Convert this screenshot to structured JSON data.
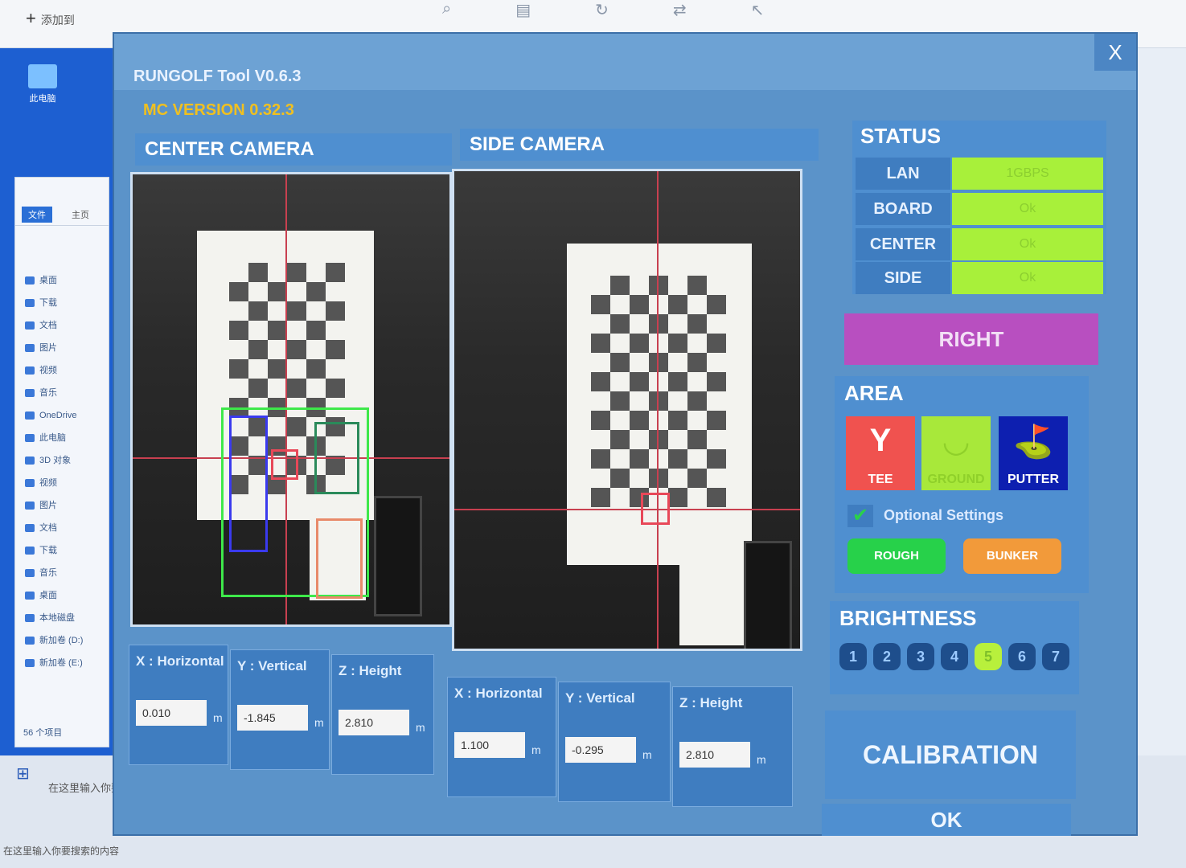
{
  "desktop": {
    "new_tab": "添加到",
    "desktop_icon": "此电脑",
    "explorer_tabs": [
      "文件",
      "主页"
    ],
    "explorer_items": [
      "桌面",
      "下载",
      "文档",
      "图片",
      "视频",
      "音乐",
      "OneDrive",
      "此电脑",
      "3D 对象",
      "视频",
      "图片",
      "文档",
      "下载",
      "音乐",
      "桌面",
      "本地磁盘",
      "新加卷 (D:)",
      "新加卷 (E:)"
    ],
    "explorer_footer": "56 个项目",
    "taskbar_search": "在这里输入你要搜索的内容",
    "taskbar_search_2": "在这里输入你要搜索的内容"
  },
  "window": {
    "title": "RUNGOLF Tool V0.6.3",
    "version": "MC VERSION  0.32.3",
    "close_label": "X"
  },
  "center_camera": {
    "header": "CENTER CAMERA",
    "labels": [
      "X : Horizontal",
      "Y : Vertical",
      "Z : Height"
    ],
    "values": [
      "0.010",
      "-1.845",
      "2.810"
    ],
    "unit": "m"
  },
  "side_camera": {
    "header": "SIDE CAMERA",
    "labels": [
      "X : Horizontal",
      "Y : Vertical",
      "Z : Height"
    ],
    "values": [
      "1.100",
      "-0.295",
      "2.810"
    ],
    "unit": "m"
  },
  "status": {
    "header": "STATUS",
    "rows": [
      {
        "key": "LAN",
        "value": "1GBPS"
      },
      {
        "key": "BOARD",
        "value": "Ok"
      },
      {
        "key": "CENTER",
        "value": "Ok"
      },
      {
        "key": "SIDE",
        "value": "Ok"
      }
    ],
    "value_color": "#a8f03a"
  },
  "right_button": {
    "label": "RIGHT",
    "color": "#b84fc0"
  },
  "area": {
    "header": "AREA",
    "buttons": [
      {
        "label": "TEE",
        "color": "#f0524f",
        "icon": "tee-icon"
      },
      {
        "label": "GROUND",
        "color": "#a8e83a",
        "icon": "ground-icon"
      },
      {
        "label": "PUTTER",
        "color": "#0d1fb0",
        "icon": "putter-icon"
      }
    ],
    "optional_settings": "Optional Settings",
    "optional_buttons": [
      {
        "label": "ROUGH",
        "color": "#27d14a"
      },
      {
        "label": "BUNKER",
        "color": "#f29a3a"
      }
    ]
  },
  "brightness": {
    "header": "BRIGHTNESS",
    "levels": [
      "1",
      "2",
      "3",
      "4",
      "5",
      "6",
      "7"
    ],
    "selected": "5"
  },
  "calibration_button": "CALIBRATION",
  "ok_button": "OK"
}
